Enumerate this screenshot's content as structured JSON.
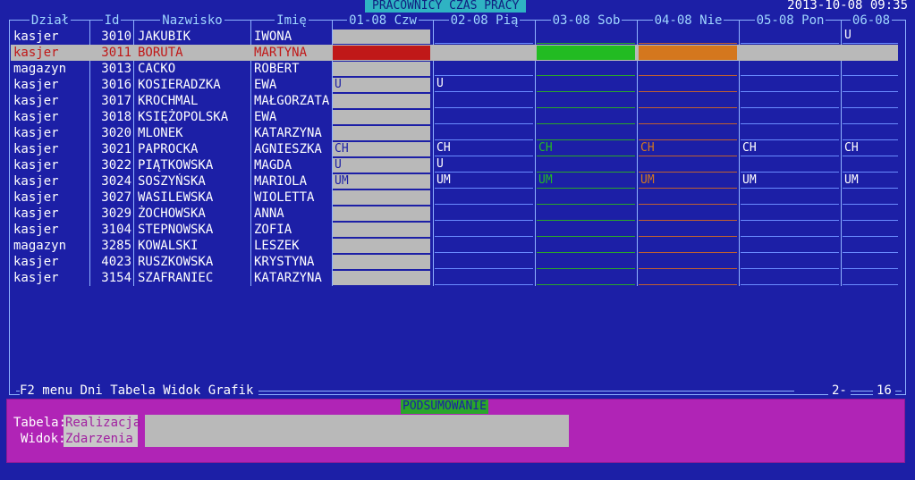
{
  "title": "PRACOWNICY CZAS PRACY",
  "datetime": "2013-10-08 09:35",
  "columns": [
    "Dział",
    "Id",
    "Nazwisko",
    "Imię"
  ],
  "days": [
    "01-08 Czw",
    "02-08 Pią",
    "03-08 Sob",
    "04-08 Nie",
    "05-08 Pon",
    "06-08"
  ],
  "colors": {
    "bg": "#1c1fa6",
    "grey": "#b9b9b9",
    "red": "#c01818",
    "green": "#22bb22",
    "orange": "#d4771e",
    "selText": "#c01818",
    "summaryBg": "#b024b6"
  },
  "rows": [
    {
      "dzial": "kasjer",
      "id": "3010",
      "nazwisko": "JAKUBIK",
      "imie": "IWONA",
      "cells": [
        "",
        "",
        "",
        "",
        "",
        "U"
      ]
    },
    {
      "dzial": "kasjer",
      "id": "3011",
      "nazwisko": "BORUTA",
      "imie": "MARTYNA",
      "cells": [
        "",
        "",
        "",
        "",
        "",
        ""
      ],
      "selected": true
    },
    {
      "dzial": "magazyn",
      "id": "3013",
      "nazwisko": "CACKO",
      "imie": "ROBERT",
      "cells": [
        "",
        "",
        "",
        "",
        "",
        ""
      ]
    },
    {
      "dzial": "kasjer",
      "id": "3016",
      "nazwisko": "KOSIERADZKA",
      "imie": "EWA",
      "cells": [
        "U",
        "U",
        "",
        "",
        "",
        ""
      ]
    },
    {
      "dzial": "kasjer",
      "id": "3017",
      "nazwisko": "KROCHMAL",
      "imie": "MAŁGORZATA",
      "cells": [
        "",
        "",
        "",
        "",
        "",
        ""
      ]
    },
    {
      "dzial": "kasjer",
      "id": "3018",
      "nazwisko": "KSIĘŻOPOLSKA",
      "imie": "EWA",
      "cells": [
        "",
        "",
        "",
        "",
        "",
        ""
      ]
    },
    {
      "dzial": "kasjer",
      "id": "3020",
      "nazwisko": "MLONEK",
      "imie": "KATARZYNA",
      "cells": [
        "",
        "",
        "",
        "",
        "",
        ""
      ]
    },
    {
      "dzial": "kasjer",
      "id": "3021",
      "nazwisko": "PAPROCKA",
      "imie": "AGNIESZKA",
      "cells": [
        "CH",
        "CH",
        "CH",
        "CH",
        "CH",
        "CH"
      ]
    },
    {
      "dzial": "kasjer",
      "id": "3022",
      "nazwisko": "PIĄTKOWSKA",
      "imie": "MAGDA",
      "cells": [
        "U",
        "U",
        "",
        "",
        "",
        ""
      ]
    },
    {
      "dzial": "kasjer",
      "id": "3024",
      "nazwisko": "SOSZYŃSKA",
      "imie": "MARIOLA",
      "cells": [
        "UM",
        "UM",
        "UM",
        "UM",
        "UM",
        "UM"
      ]
    },
    {
      "dzial": "kasjer",
      "id": "3027",
      "nazwisko": "WASILEWSKA",
      "imie": "WIOLETTA",
      "cells": [
        "",
        "",
        "",
        "",
        "",
        ""
      ]
    },
    {
      "dzial": "kasjer",
      "id": "3029",
      "nazwisko": "ŻOCHOWSKA",
      "imie": "ANNA",
      "cells": [
        "",
        "",
        "",
        "",
        "",
        ""
      ]
    },
    {
      "dzial": "kasjer",
      "id": "3104",
      "nazwisko": "STEPNOWSKA",
      "imie": "ZOFIA",
      "cells": [
        "",
        "",
        "",
        "",
        "",
        ""
      ]
    },
    {
      "dzial": "magazyn",
      "id": "3285",
      "nazwisko": "KOWALSKI",
      "imie": "LESZEK",
      "cells": [
        "",
        "",
        "",
        "",
        "",
        ""
      ]
    },
    {
      "dzial": "kasjer",
      "id": "4023",
      "nazwisko": "RUSZKOWSKA",
      "imie": "KRYSTYNA",
      "cells": [
        "",
        "",
        "",
        "",
        "",
        ""
      ]
    },
    {
      "dzial": "kasjer",
      "id": "3154",
      "nazwisko": "SZAFRANIEC",
      "imie": "KATARZYNA",
      "cells": [
        "",
        "",
        "",
        "",
        "",
        ""
      ]
    }
  ],
  "menu": {
    "f2": "F2 menu",
    "items": [
      "Dni",
      "Tabela",
      "Widok",
      "Grafik"
    ]
  },
  "pager": {
    "current": "2-",
    "total": "16"
  },
  "summary": {
    "title": "PODSUMOWANIE",
    "tabela_label": "Tabela:",
    "tabela_value": "Realizacja",
    "widok_label": "Widok:",
    "widok_value": "Zdarzenia"
  }
}
